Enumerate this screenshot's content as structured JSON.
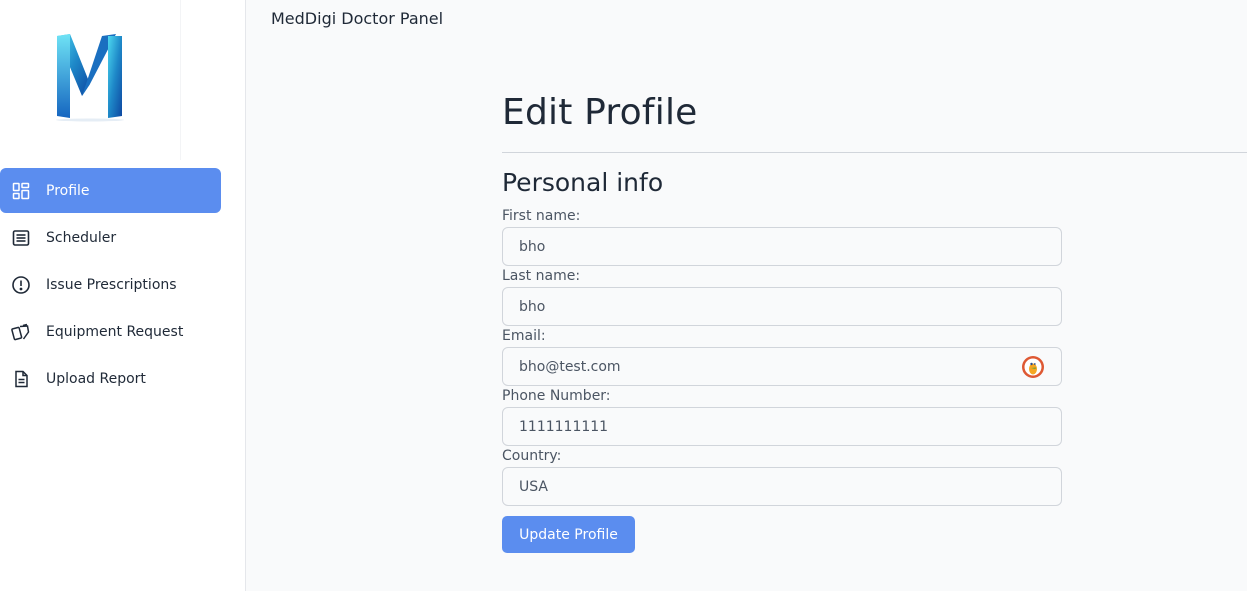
{
  "header": {
    "title": "MedDigi Doctor Panel"
  },
  "sidebar": {
    "items": [
      {
        "label": "Profile",
        "icon": "dashboard-icon",
        "active": true
      },
      {
        "label": "Scheduler",
        "icon": "list-icon",
        "active": false
      },
      {
        "label": "Issue Prescriptions",
        "icon": "alert-circle-icon",
        "active": false
      },
      {
        "label": "Equipment Request",
        "icon": "cards-icon",
        "active": false
      },
      {
        "label": "Upload Report",
        "icon": "document-icon",
        "active": false
      }
    ]
  },
  "main": {
    "title": "Edit Profile",
    "section_title": "Personal info",
    "fields": {
      "first_name": {
        "label": "First name:",
        "value": "bho"
      },
      "last_name": {
        "label": "Last name:",
        "value": "bho"
      },
      "email": {
        "label": "Email:",
        "value": "bho@test.com"
      },
      "phone": {
        "label": "Phone Number:",
        "value": "1111111111"
      },
      "country": {
        "label": "Country:",
        "value": "USA"
      }
    },
    "submit_label": "Update Profile"
  },
  "colors": {
    "accent": "#5b8def",
    "background": "#f9fafb",
    "sidebar": "#ffffff",
    "text": "#1f2937"
  }
}
